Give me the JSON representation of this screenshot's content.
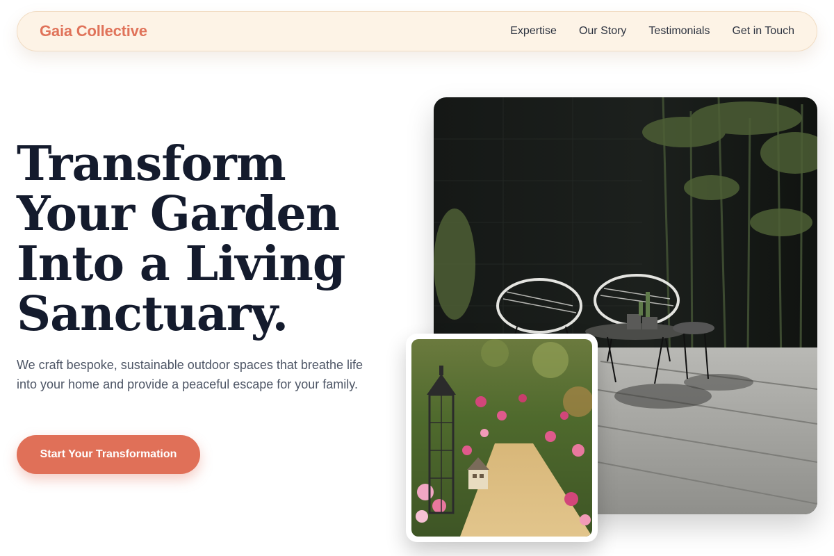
{
  "nav": {
    "brand": "Gaia Collective",
    "links": [
      "Expertise",
      "Our Story",
      "Testimonials",
      "Get in Touch"
    ]
  },
  "hero": {
    "headline": "Transform Your Garden Into a Living Sanctuary.",
    "subtitle": "We craft bespoke, sustainable outdoor spaces that breathe life into your home and provide a peaceful escape for your family.",
    "cta_label": "Start Your Transformation"
  },
  "colors": {
    "accent": "#e07058",
    "nav_bg": "#fdf3e6",
    "headline": "#141b2d",
    "body_text": "#4d5565"
  },
  "images": {
    "main": "patio-with-chairs-photo",
    "secondary": "fairy-garden-path-photo"
  }
}
